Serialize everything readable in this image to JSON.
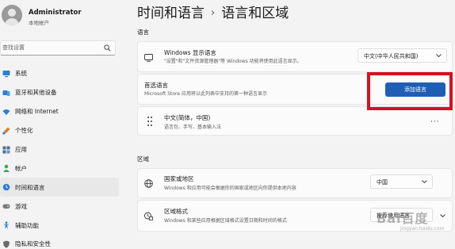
{
  "user": {
    "name": "Administrator",
    "account_type": "本地帐户"
  },
  "search": {
    "placeholder": "查找设置"
  },
  "sidebar": {
    "items": [
      {
        "label": "系统",
        "icon": "monitor-icon"
      },
      {
        "label": "蓝牙和其他设备",
        "icon": "bluetooth-icon"
      },
      {
        "label": "网络和 Internet",
        "icon": "wifi-icon"
      },
      {
        "label": "个性化",
        "icon": "brush-icon"
      },
      {
        "label": "应用",
        "icon": "apps-icon"
      },
      {
        "label": "帐户",
        "icon": "person-icon"
      },
      {
        "label": "时间和语言",
        "icon": "clock-globe-icon",
        "active": true
      },
      {
        "label": "游戏",
        "icon": "gamepad-icon"
      },
      {
        "label": "辅助功能",
        "icon": "accessibility-icon"
      },
      {
        "label": "隐私和安全性",
        "icon": "shield-icon"
      }
    ]
  },
  "header": {
    "parent": "时间和语言",
    "separator": "›",
    "current": "语言和区域"
  },
  "language": {
    "section_label": "语言",
    "display_language": {
      "title": "Windows 显示语言",
      "desc": "\"设置\"和\"文件资源管理器\"等 Windows 功能将使用此语言显示。",
      "value": "中文(中华人民共和国)"
    },
    "preferred": {
      "title": "首选语言",
      "desc": "Microsoft Store 应用将以此列表中支持的第一种语言显示",
      "button_label": "添加语言"
    },
    "installed": {
      "title": "中文(简体，中国)",
      "desc": "语言包、手写、基本输入法",
      "more_label": "···"
    }
  },
  "region": {
    "section_label": "区域",
    "country": {
      "title": "国家或地区",
      "desc": "Windows 和应用可能会根据你的国家或地区向你提供本地内容",
      "value": "中国"
    },
    "format": {
      "title": "区域格式",
      "desc": "Windows 和某些应用根据区域格式设置日期和时间的格式",
      "value": "推荐使用语言"
    }
  },
  "watermark": {
    "text": "Bai百度",
    "sub": "jingyan.baidu.com"
  },
  "colors": {
    "accent": "#1f5fb3",
    "highlight": "#d4121e"
  }
}
